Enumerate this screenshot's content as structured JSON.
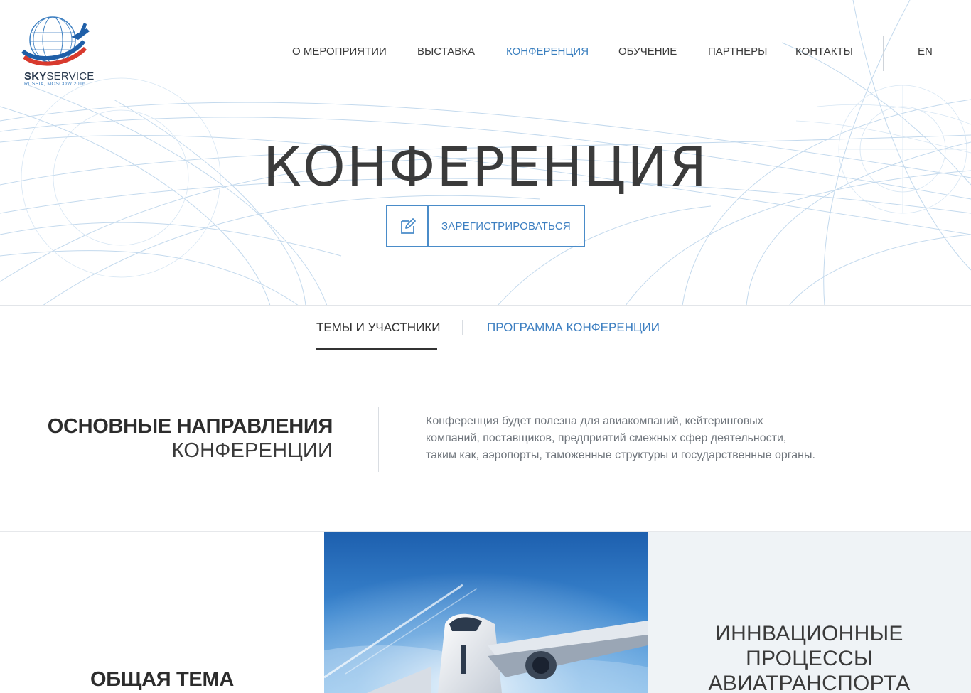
{
  "logo": {
    "name_bold": "SKY",
    "name_rest": "SERVICE",
    "subtitle": "RUSSIA, MOSCOW 2016"
  },
  "nav": {
    "items": [
      {
        "label": "О МЕРОПРИЯТИИ",
        "active": false
      },
      {
        "label": "ВЫСТАВКА",
        "active": false
      },
      {
        "label": "КОНФЕРЕНЦИЯ",
        "active": true
      },
      {
        "label": "ОБУЧЕНИЕ",
        "active": false
      },
      {
        "label": "ПАРТНЕРЫ",
        "active": false
      },
      {
        "label": "КОНТАКТЫ",
        "active": false
      }
    ],
    "lang": "EN"
  },
  "hero": {
    "title": "КОНФЕРЕНЦИЯ",
    "register_label": "ЗАРЕГИСТРИРОВАТЬСЯ",
    "register_icon": "edit-icon"
  },
  "tabs": [
    {
      "label": "ТЕМЫ И УЧАСТНИКИ",
      "active": true
    },
    {
      "label": "ПРОГРАММА КОНФЕРЕНЦИИ",
      "active": false
    }
  ],
  "directions": {
    "title_bold": "ОСНОВНЫЕ НАПРАВЛЕНИЯ",
    "title_light": "КОНФЕРЕНЦИИ",
    "text_lines": [
      "Конференция будет полезна для авиакомпаний, кейтеринговых",
      "компаний, поставщиков, предприятий смежных сфер деятельности,",
      "таким как, аэропорты, таможенные структуры и государственные органы."
    ]
  },
  "cards": {
    "left_title": "ОБЩАЯ ТЕМА",
    "image": "airplane-sky-image",
    "right_title_lines": [
      "ИННВАЦИОННЫЕ",
      "ПРОЦЕССЫ",
      "АВИАТРАНСПОРТА"
    ]
  },
  "colors": {
    "accent": "#3d7fc1",
    "text": "#333333",
    "muted": "#6f757c",
    "card_bg": "#eff3f6"
  }
}
